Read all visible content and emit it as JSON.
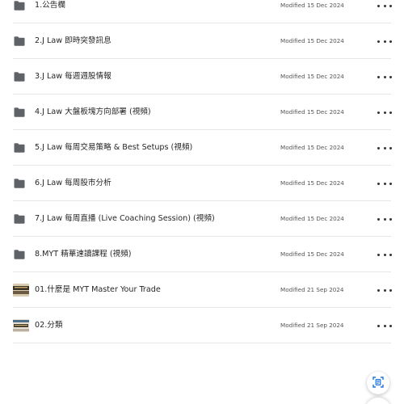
{
  "items": [
    {
      "type": "folder",
      "name": "1.公告欄",
      "modified": "Modified 15 Dec 2024"
    },
    {
      "type": "folder",
      "name": "2.J Law 即時突發訊息",
      "modified": "Modified 15 Dec 2024"
    },
    {
      "type": "folder",
      "name": "3.J Law 每週週股情報",
      "modified": "Modified 15 Dec 2024"
    },
    {
      "type": "folder",
      "name": "4.J Law 大盤板塊方向部署 (視頻)",
      "modified": "Modified 15 Dec 2024"
    },
    {
      "type": "folder",
      "name": "5.J Law 每周交易策略 & Best Setups (視頻)",
      "modified": "Modified 15 Dec 2024"
    },
    {
      "type": "folder",
      "name": "6.J Law 每周股市分析",
      "modified": "Modified 15 Dec 2024"
    },
    {
      "type": "folder",
      "name": "7.J Law 每周直播 (Live Coaching Session) (視頻)",
      "modified": "Modified 15 Dec 2024"
    },
    {
      "type": "folder",
      "name": "8.MYT 精華速讀課程 (視頻)",
      "modified": "Modified 15 Dec 2024"
    },
    {
      "type": "file",
      "name": "01.什麼是 MYT Master Your Trade",
      "modified": "Modified 21 Sep 2024"
    },
    {
      "type": "file",
      "name": "02.分類",
      "modified": "Modified 21 Sep 2024"
    }
  ],
  "colors": {
    "folder": "#5f6368",
    "fab_accent": "#1a73e8"
  },
  "fab": {
    "icon": "scan-document-icon"
  }
}
